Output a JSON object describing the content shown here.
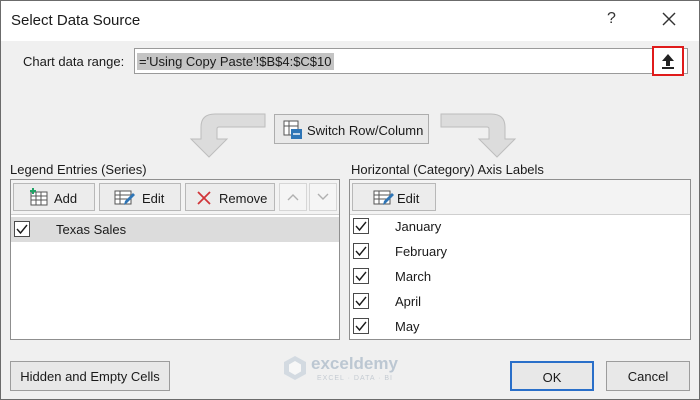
{
  "window": {
    "title": "Select Data Source",
    "help_label": "?"
  },
  "range": {
    "label": "Chart data range:",
    "value": "='Using Copy Paste'!$B$4:$C$10"
  },
  "switch_button": {
    "label": "Switch Row/Column"
  },
  "legend": {
    "heading": "Legend Entries (Series)",
    "add_label": "Add",
    "edit_label": "Edit",
    "remove_label": "Remove",
    "series": [
      {
        "name": "Texas Sales",
        "checked": true
      }
    ]
  },
  "axis": {
    "heading": "Horizontal (Category) Axis Labels",
    "edit_label": "Edit",
    "labels": [
      "January",
      "February",
      "March",
      "April",
      "May"
    ]
  },
  "footer": {
    "hidden_cells_label": "Hidden and Empty Cells",
    "ok_label": "OK",
    "cancel_label": "Cancel"
  },
  "watermark": {
    "name": "exceldemy",
    "tagline": "EXCEL · DATA · BI"
  },
  "colors": {
    "highlight_border": "#e01b1b",
    "default_button_border": "#2a6fc9",
    "selected_row": "#dcdcdc",
    "icon_blue": "#2e75b6",
    "icon_green": "#21a366"
  }
}
